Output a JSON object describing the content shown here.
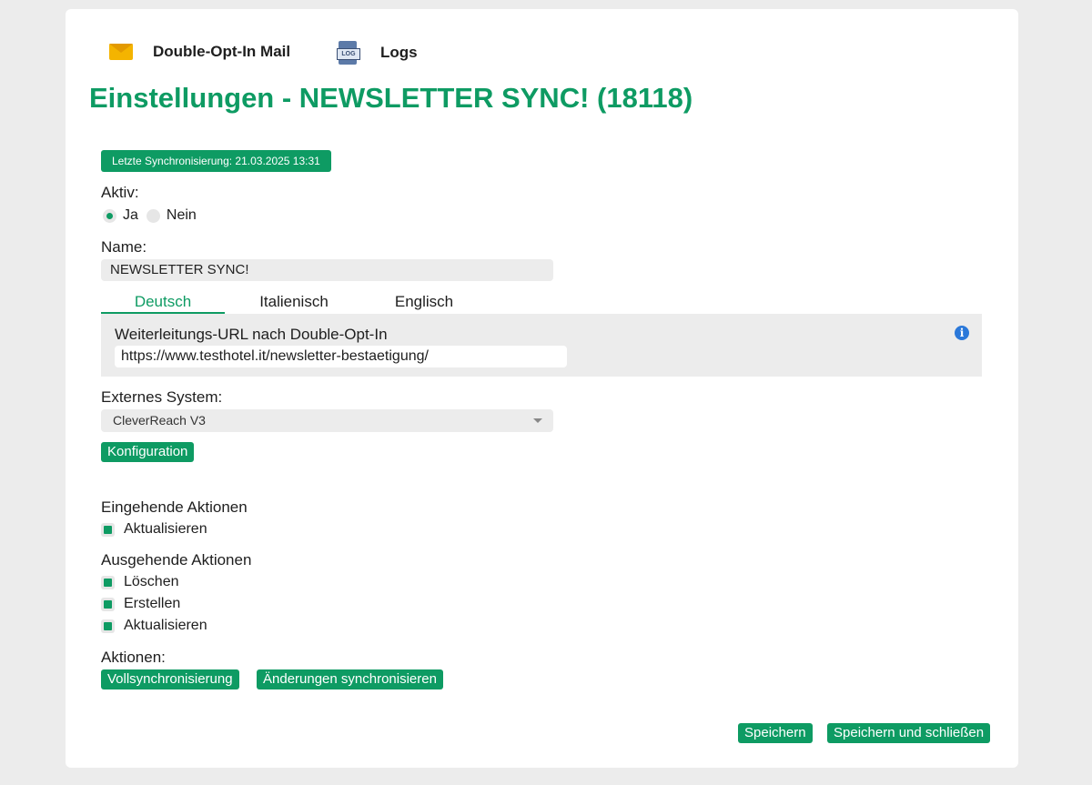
{
  "nav": {
    "doi_mail": "Double-Opt-In Mail",
    "logs": "Logs",
    "log_icon_text": "LOG"
  },
  "page_title": "Einstellungen - NEWSLETTER SYNC! (18118)",
  "last_sync": "Letzte Synchronisierung: 21.03.2025 13:31",
  "active": {
    "label": "Aktiv:",
    "options": [
      "Ja",
      "Nein"
    ],
    "selected": "Ja"
  },
  "name": {
    "label": "Name:",
    "value": "NEWSLETTER SYNC!"
  },
  "tabs": [
    {
      "label": "Deutsch",
      "active": true
    },
    {
      "label": "Italienisch",
      "active": false
    },
    {
      "label": "Englisch",
      "active": false
    }
  ],
  "redirect": {
    "label": "Weiterleitungs-URL nach Double-Opt-In",
    "value": "https://www.testhotel.it/newsletter-bestaetigung/",
    "info_icon": "i"
  },
  "external_system": {
    "label": "Externes System:",
    "selected": "CleverReach V3"
  },
  "config_button": "Konfiguration",
  "incoming": {
    "label": "Eingehende Aktionen",
    "items": [
      {
        "label": "Aktualisieren",
        "checked": true
      }
    ]
  },
  "outgoing": {
    "label": "Ausgehende Aktionen",
    "items": [
      {
        "label": "Löschen",
        "checked": true
      },
      {
        "label": "Erstellen",
        "checked": true
      },
      {
        "label": "Aktualisieren",
        "checked": true
      }
    ]
  },
  "actions": {
    "label": "Aktionen:",
    "full_sync": "Vollsynchronisierung",
    "sync_changes": "Änderungen synchronisieren"
  },
  "footer": {
    "save": "Speichern",
    "save_close": "Speichern und schließen"
  },
  "colors": {
    "accent": "#0e9b63",
    "background": "#ececec",
    "info": "#2b78d9"
  }
}
